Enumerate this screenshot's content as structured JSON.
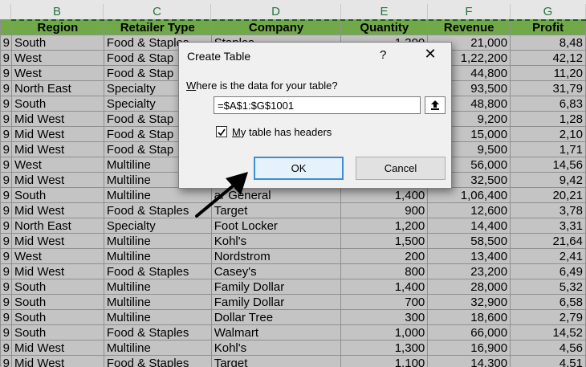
{
  "columns": [
    "",
    "B",
    "C",
    "D",
    "E",
    "F",
    "G"
  ],
  "headers": [
    "",
    "Region",
    "Retailer Type",
    "Company",
    "Quantity",
    "Revenue",
    "Profit"
  ],
  "rows": [
    [
      "9",
      "South",
      "Food & Staples",
      "Staples",
      "1,300",
      "21,000",
      "8,48"
    ],
    [
      "9",
      "West",
      "Food & Stap",
      "",
      "",
      "1,22,200",
      "42,12"
    ],
    [
      "9",
      "West",
      "Food & Stap",
      "",
      "",
      "44,800",
      "11,20"
    ],
    [
      "9",
      "North East",
      "Specialty",
      "",
      "",
      "93,500",
      "31,79"
    ],
    [
      "9",
      "South",
      "Specialty",
      "",
      "",
      "48,800",
      "6,83"
    ],
    [
      "9",
      "Mid West",
      "Food & Stap",
      "",
      "",
      "9,200",
      "1,28"
    ],
    [
      "9",
      "Mid West",
      "Food & Stap",
      "",
      "",
      "15,000",
      "2,10"
    ],
    [
      "9",
      "Mid West",
      "Food & Stap",
      "",
      "",
      "9,500",
      "1,71"
    ],
    [
      "9",
      "West",
      "Multiline",
      "",
      "",
      "56,000",
      "14,56"
    ],
    [
      "9",
      "Mid West",
      "Multiline",
      "",
      "",
      "32,500",
      "9,42"
    ],
    [
      "9",
      "South",
      "Multiline",
      "ar General",
      "1,400",
      "1,06,400",
      "20,21"
    ],
    [
      "9",
      "Mid West",
      "Food & Staples",
      "Target",
      "900",
      "12,600",
      "3,78"
    ],
    [
      "9",
      "North East",
      "Specialty",
      "Foot Locker",
      "1,200",
      "14,400",
      "3,31"
    ],
    [
      "9",
      "Mid West",
      "Multiline",
      "Kohl's",
      "1,500",
      "58,500",
      "21,64"
    ],
    [
      "9",
      "West",
      "Multiline",
      "Nordstrom",
      "200",
      "13,400",
      "2,41"
    ],
    [
      "9",
      "Mid West",
      "Food & Staples",
      "Casey's",
      "800",
      "23,200",
      "6,49"
    ],
    [
      "9",
      "South",
      "Multiline",
      "Family Dollar",
      "1,400",
      "28,000",
      "5,32"
    ],
    [
      "9",
      "South",
      "Multiline",
      "Family Dollar",
      "700",
      "32,900",
      "6,58"
    ],
    [
      "9",
      "South",
      "Multiline",
      "Dollar Tree",
      "300",
      "18,600",
      "2,79"
    ],
    [
      "9",
      "South",
      "Food & Staples",
      "Walmart",
      "1,000",
      "66,000",
      "14,52"
    ],
    [
      "9",
      "Mid West",
      "Multiline",
      "Kohl's",
      "1,300",
      "16,900",
      "4,56"
    ],
    [
      "9",
      "Mid West",
      "Food & Staples",
      "Target",
      "1,100",
      "14,300",
      "4,51"
    ]
  ],
  "dialog": {
    "title": "Create Table",
    "help": "?",
    "close": "✕",
    "prompt": "Where is the data for your table?",
    "range_value": "=$A$1:$G$1001",
    "checkbox_label": "My table has headers",
    "checkbox_checked": true,
    "ok_label": "OK",
    "cancel_label": "Cancel"
  },
  "colors": {
    "header_fill": "#71a94a",
    "ok_border": "#3c8fd6",
    "column_letter": "#217346"
  },
  "icons": [
    "collapse-dialog-icon",
    "checkmark-icon",
    "pointer-arrow-icon"
  ]
}
